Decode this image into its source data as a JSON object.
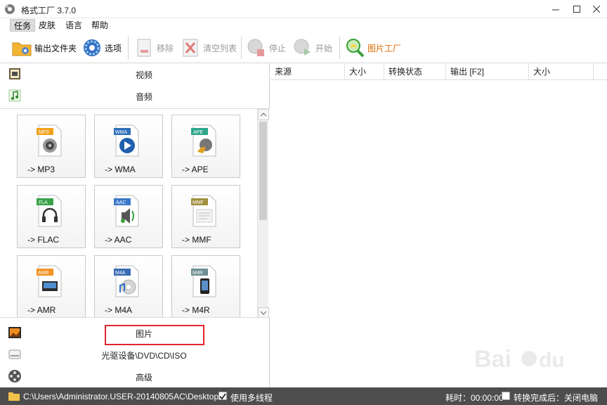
{
  "window": {
    "title": "格式工厂 3.7.0"
  },
  "menu": [
    "任务",
    "皮肤",
    "语言",
    "帮助"
  ],
  "toolbar": {
    "output_folder": "输出文件夹",
    "options": "选项",
    "remove": "移除",
    "clear_list": "清空列表",
    "stop": "停止",
    "start": "开始",
    "image_factory": "图片工厂"
  },
  "categories": {
    "video": "视频",
    "audio": "音频",
    "picture": "图片",
    "rom": "光驱设备\\DVD\\CD\\ISO",
    "advanced": "高级"
  },
  "audio_formats": [
    {
      "badge": "MP3",
      "label": "-> MP3",
      "color": "#f0a21a"
    },
    {
      "badge": "WMA",
      "label": "-> WMA",
      "color": "#2f6fb8"
    },
    {
      "badge": "APE",
      "label": "-> APE",
      "color": "#2fa58c"
    },
    {
      "badge": "FLA",
      "label": "-> FLAC",
      "color": "#3aa24a"
    },
    {
      "badge": "AAC",
      "label": "-> AAC",
      "color": "#3b78c9"
    },
    {
      "badge": "MMF",
      "label": "-> MMF",
      "color": "#a39040"
    },
    {
      "badge": "AMR",
      "label": "-> AMR",
      "color": "#f29322"
    },
    {
      "badge": "M4A",
      "label": "-> M4A",
      "color": "#3a6cb5"
    },
    {
      "badge": "M4R",
      "label": "-> M4R",
      "color": "#6e8f92"
    }
  ],
  "table_headers": [
    "来源",
    "大小",
    "转换状态",
    "输出 [F2]",
    "大小"
  ],
  "status": {
    "path": "C:\\Users\\Administrator.USER-20140805AC\\Desktop",
    "multithread": "使用多线程",
    "elapsed": "耗时：00:00:00",
    "shutdown": "转换完成后：关闭电脑"
  }
}
